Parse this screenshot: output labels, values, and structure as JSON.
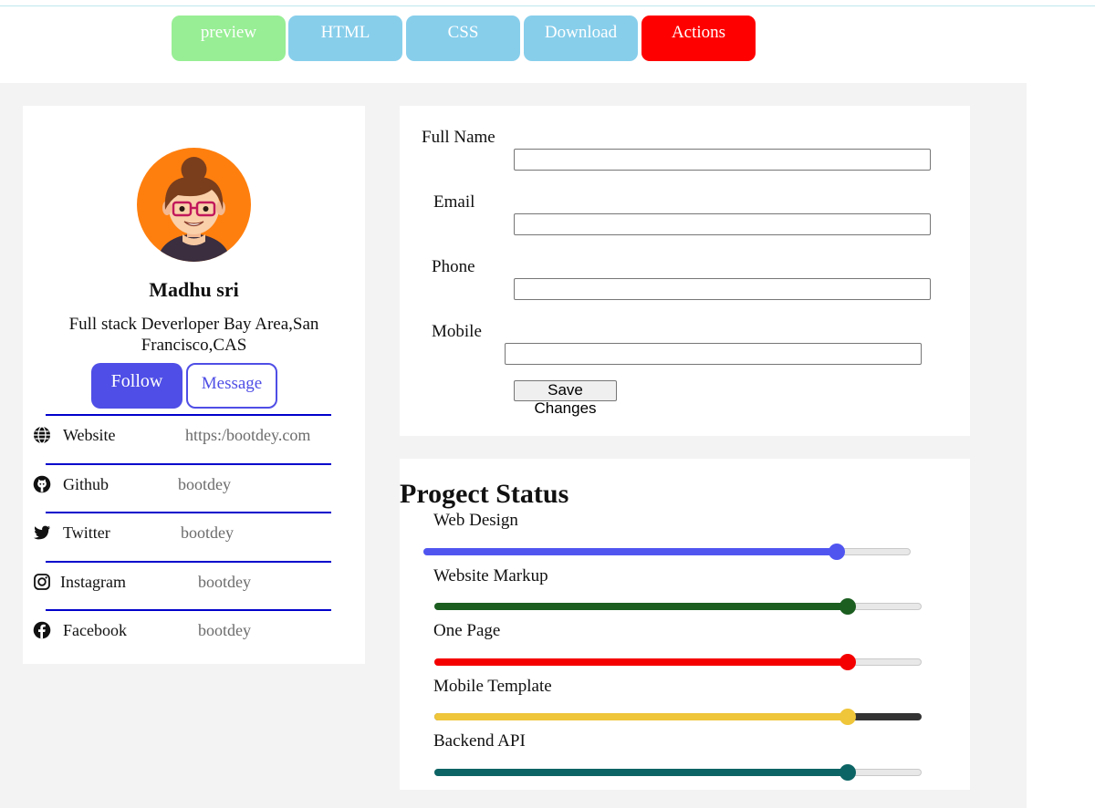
{
  "toolbar": {
    "preview": "preview",
    "html": "HTML",
    "css": "CSS",
    "download": "Download",
    "actions": "Actions"
  },
  "profile": {
    "name": "Madhu sri",
    "bio": "Full stack Deverloper Bay Area,San Francisco,CAS",
    "follow": "Follow",
    "message": "Message",
    "avatar_icon": "avatar-icon",
    "social": [
      {
        "icon": "globe-icon",
        "label": "Website",
        "value": "https:/bootdey.com"
      },
      {
        "icon": "github-icon",
        "label": "Github",
        "value": "bootdey"
      },
      {
        "icon": "twitter-icon",
        "label": "Twitter",
        "value": "bootdey"
      },
      {
        "icon": "instagram-icon",
        "label": "Instagram",
        "value": "bootdey"
      },
      {
        "icon": "facebook-icon",
        "label": "Facebook",
        "value": "bootdey"
      }
    ]
  },
  "form": {
    "full_name_label": "Full Name",
    "email_label": "Email",
    "phone_label": "Phone",
    "mobile_label": "Mobile",
    "full_name_value": "",
    "email_value": "",
    "phone_value": "",
    "mobile_value": "",
    "save": "Save Changes"
  },
  "status": {
    "title": "Progect Status",
    "items": [
      {
        "label": "Web Design",
        "percent": 85,
        "color": "#5055f0"
      },
      {
        "label": "Website Markup",
        "percent": 85,
        "color": "#1b5e20"
      },
      {
        "label": "One Page",
        "percent": 85,
        "color": "#f50000"
      },
      {
        "label": "Mobile Template",
        "percent": 85,
        "color": "#efc53a",
        "track_color": "#333333"
      },
      {
        "label": "Backend API",
        "percent": 85,
        "color": "#0d6464"
      }
    ]
  },
  "colors": {
    "accent": "#4f4ee6",
    "preview_button": "#98ee95",
    "tab_button": "#87ceeb",
    "actions_button": "#fe0000",
    "avatar_bg": "#ff7f0e"
  }
}
